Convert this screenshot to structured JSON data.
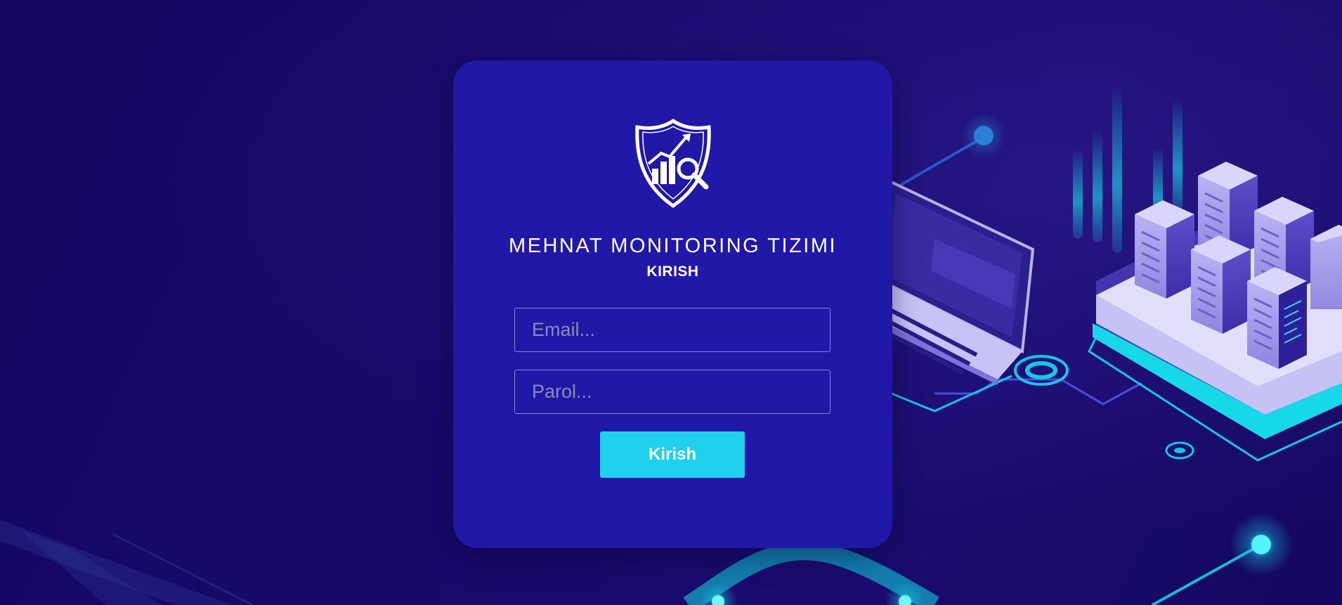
{
  "login": {
    "title": "MEHNAT MONITORING TIZIMI",
    "subtitle": "KIRISH",
    "email_placeholder": "Email...",
    "email_value": "",
    "password_placeholder": "Parol...",
    "password_value": "",
    "submit_label": "Kirish"
  },
  "theme": {
    "background": "#15085e",
    "card": "#2118a8",
    "accent": "#21d0ec",
    "text": "#ffffff"
  },
  "icons": {
    "logo": "shield-chart-magnifier-icon"
  }
}
